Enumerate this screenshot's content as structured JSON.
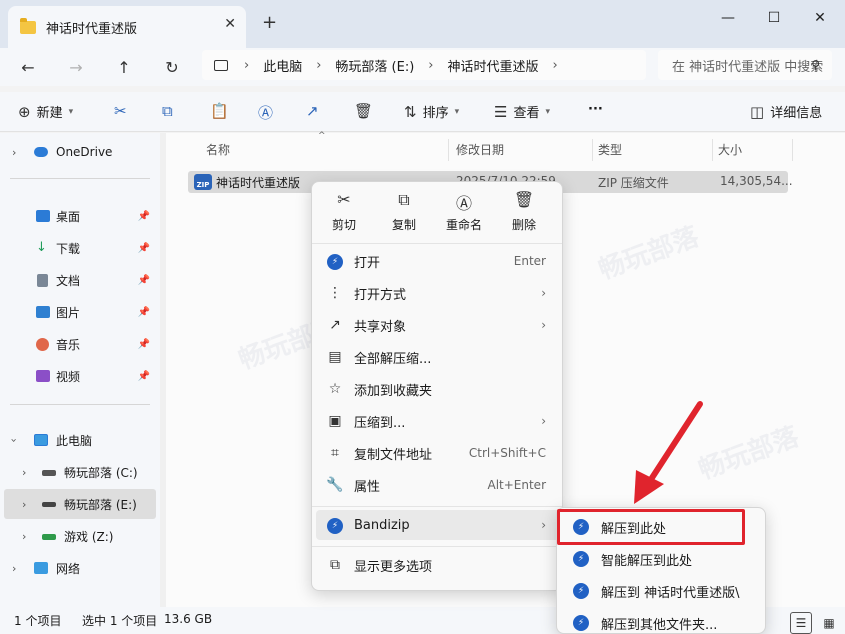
{
  "titlebar": {
    "tab_title": "神话时代重述版",
    "tab_close": "✕",
    "new_tab": "+",
    "minimize": "—",
    "maximize": "☐",
    "close": "✕"
  },
  "nav": {
    "back": "←",
    "forward": "→",
    "up": "↑",
    "refresh": "↻",
    "crumbs": [
      "此电脑",
      "畅玩部落 (E:)",
      "神话时代重述版"
    ],
    "sep": "›",
    "search_placeholder": "在 神话时代重述版 中搜索"
  },
  "commands": {
    "new": "新建",
    "sort": "排序",
    "view": "查看",
    "more": "···",
    "details": "详细信息"
  },
  "sidebar": {
    "onedrive": "OneDrive",
    "quick": [
      {
        "label": "桌面",
        "icon": "desktop-icon",
        "color": "#2b7bd6"
      },
      {
        "label": "下载",
        "icon": "download-icon",
        "color": "#1f9c5a"
      },
      {
        "label": "文档",
        "icon": "document-icon",
        "color": "#7a8796"
      },
      {
        "label": "图片",
        "icon": "pictures-icon",
        "color": "#2f80d1"
      },
      {
        "label": "音乐",
        "icon": "music-icon",
        "color": "#e0674a"
      },
      {
        "label": "视频",
        "icon": "video-icon",
        "color": "#8b4fc7"
      }
    ],
    "this_pc": "此电脑",
    "drives": [
      {
        "label": "畅玩部落 (C:)"
      },
      {
        "label": "畅玩部落 (E:)"
      },
      {
        "label": "游戏 (Z:)"
      }
    ],
    "network": "网络"
  },
  "columns": {
    "name": "名称",
    "date": "修改日期",
    "type": "类型",
    "size": "大小"
  },
  "file": {
    "icon_text": "ZIP",
    "name": "神话时代重述版",
    "date": "2025/7/10 22:59",
    "type": "ZIP 压缩文件",
    "size": "14,305,54..."
  },
  "status": {
    "count": "1 个项目",
    "selected": "选中 1 个项目",
    "size": "13.6 GB"
  },
  "context_menu": {
    "quick": [
      {
        "label": "剪切",
        "glyph": "✂"
      },
      {
        "label": "复制",
        "glyph": "⧉"
      },
      {
        "label": "重命名",
        "glyph": "Ⓐ"
      },
      {
        "label": "删除",
        "glyph": "🗑"
      }
    ],
    "items": [
      {
        "label": "打开",
        "key": "Enter",
        "glyph": "●"
      },
      {
        "label": "打开方式",
        "key": "",
        "glyph": "⋮"
      },
      {
        "label": "共享对象",
        "key": "",
        "glyph": "↗"
      },
      {
        "label": "全部解压缩...",
        "key": "",
        "glyph": "▤"
      },
      {
        "label": "添加到收藏夹",
        "key": "",
        "glyph": "☆"
      },
      {
        "label": "压缩到...",
        "key": "",
        "glyph": "▣"
      },
      {
        "label": "复制文件地址",
        "key": "Ctrl+Shift+C",
        "glyph": "⌗"
      },
      {
        "label": "属性",
        "key": "Alt+Enter",
        "glyph": "🔧"
      }
    ],
    "bandizip": "Bandizip",
    "more": "显示更多选项",
    "arrow": "›"
  },
  "submenu": {
    "items": [
      "解压到此处",
      "智能解压到此处",
      "解压到 神话时代重述版\\",
      "解压到其他文件夹..."
    ]
  },
  "colors": {
    "accent": "#2161c4",
    "highlight": "#e0242d"
  }
}
